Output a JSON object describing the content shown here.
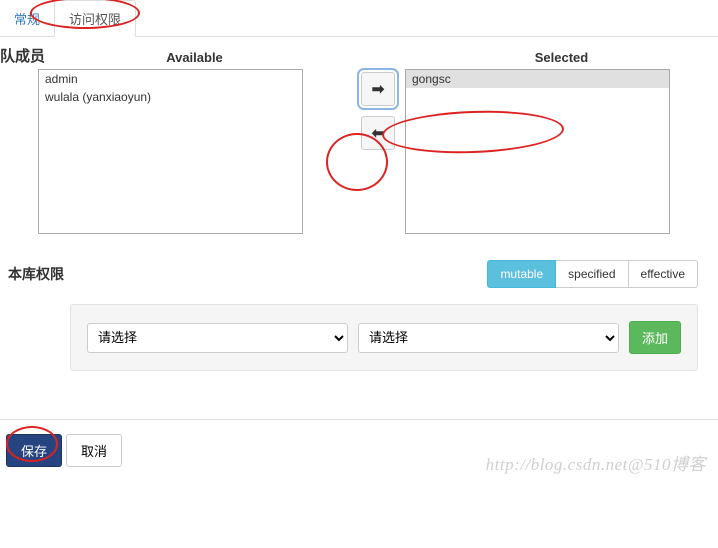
{
  "tabs": {
    "general": "常规",
    "access": "访问权限"
  },
  "team": {
    "heading": "队成员",
    "available_label": "Available",
    "selected_label": "Selected",
    "available_items": [
      "admin",
      "wulala (yanxiaoyun)"
    ],
    "selected_items": [
      "gongsc"
    ]
  },
  "permissions": {
    "heading": "本库权限",
    "segments": {
      "mutable": "mutable",
      "specified": "specified",
      "effective": "effective"
    },
    "select_placeholder": "请选择",
    "add_label": "添加"
  },
  "footer": {
    "save": "保存",
    "cancel": "取消"
  },
  "watermark": "http://blog.csdn.net@510博客"
}
